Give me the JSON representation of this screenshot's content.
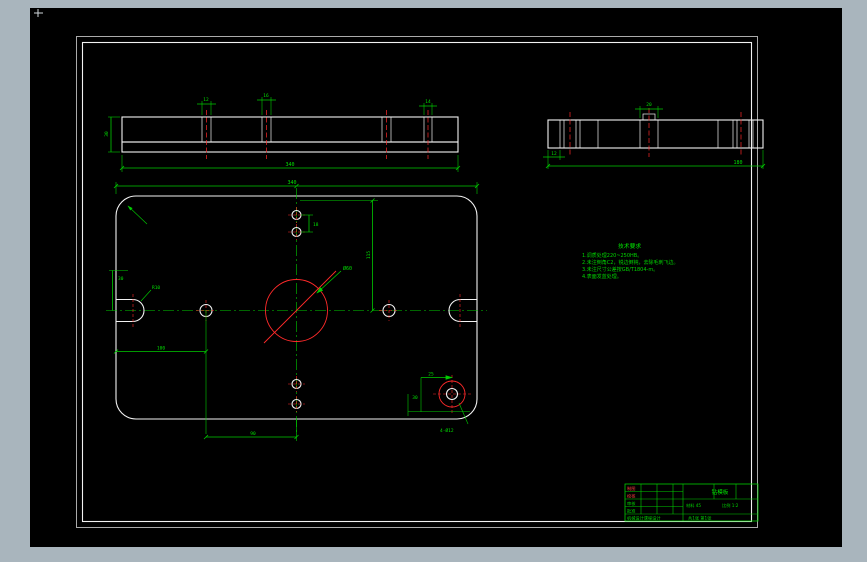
{
  "window": {
    "bg": "#a9b5bd",
    "canvas_bg": "#000000"
  },
  "palette": {
    "outline": "#f2f2f2",
    "dimension": "#00cc00",
    "centerline": "#ff2a2a"
  },
  "section_front": {
    "dims": {
      "hole1": "12",
      "hole2": "16",
      "hole3": "14",
      "length": "340",
      "height": "30"
    }
  },
  "section_side": {
    "dims": {
      "slot": "12",
      "boss": "20",
      "length": "180"
    }
  },
  "plan": {
    "dims": {
      "width": "340",
      "height_right": "115",
      "bore": "Ø60",
      "slot_radius": "R10",
      "edge_offset": "30",
      "left_span": "100",
      "bottom_span": "90",
      "hole_pair": "18",
      "br_x": "25",
      "br_y": "30",
      "br_callout": "4-Ø12"
    }
  },
  "notes": {
    "title": "技术要求",
    "lines": [
      "1.调质处理220~250HB。",
      "2.未注倒角C2，锐边倒钝，去除毛刺飞边。",
      "3.未注尺寸公差按GB/T1804-m。",
      "4.表面发蓝处理。"
    ]
  },
  "title_block": {
    "design": "制图",
    "check": "校核",
    "audit": "审核",
    "approve": "批准",
    "part_name": "钻模板",
    "material": "材料 45",
    "scale": "比例 1:2",
    "org": "机械设计课程设计",
    "sheet": "共1张 第1张"
  }
}
